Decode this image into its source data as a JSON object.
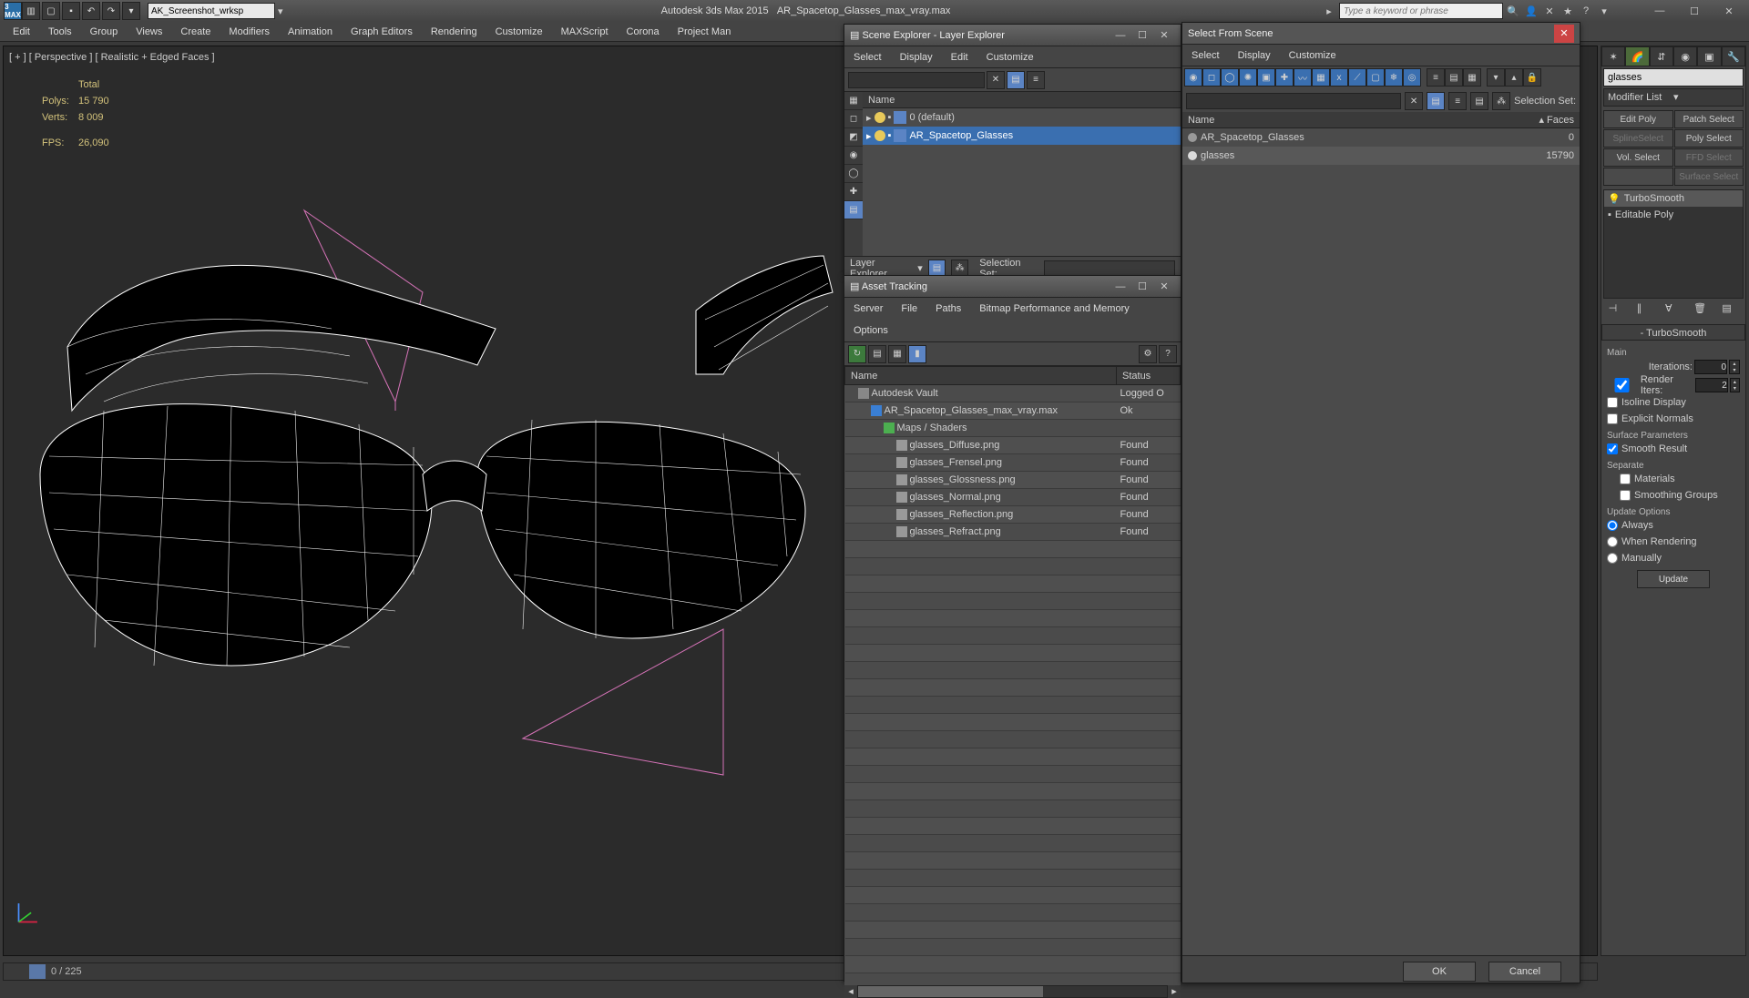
{
  "app": {
    "title_left": "Autodesk 3ds Max  2015",
    "filename": "AR_Spacetop_Glasses_max_vray.max",
    "workspace": "AK_Screenshot_wrksp",
    "search_placeholder": "Type a keyword or phrase"
  },
  "menu": [
    "Edit",
    "Tools",
    "Group",
    "Views",
    "Create",
    "Modifiers",
    "Animation",
    "Graph Editors",
    "Rendering",
    "Customize",
    "MAXScript",
    "Corona",
    "Project Man"
  ],
  "viewport": {
    "label": "[ + ] [ Perspective ] [ Realistic + Edged Faces ]",
    "stats": {
      "total_label": "Total",
      "polys_label": "Polys:",
      "polys": "15 790",
      "verts_label": "Verts:",
      "verts": "8 009",
      "fps_label": "FPS:",
      "fps": "26,090"
    }
  },
  "timeline": {
    "frame": "0 / 225"
  },
  "scene_explorer": {
    "title": "Scene Explorer - Layer Explorer",
    "menu": [
      "Select",
      "Display",
      "Edit",
      "Customize"
    ],
    "name_col": "Name",
    "items": [
      {
        "label": "0 (default)",
        "sel": false
      },
      {
        "label": "AR_Spacetop_Glasses",
        "sel": true
      }
    ],
    "status_label": "Layer Explorer",
    "selset_label": "Selection Set:"
  },
  "asset_tracking": {
    "title": "Asset Tracking",
    "menu": [
      "Server",
      "File",
      "Paths",
      "Bitmap Performance and Memory",
      "Options"
    ],
    "cols": {
      "name": "Name",
      "status": "Status"
    },
    "rows": [
      {
        "name": "Autodesk Vault",
        "status": "Logged O",
        "indent": 1,
        "icon": "#888"
      },
      {
        "name": "AR_Spacetop_Glasses_max_vray.max",
        "status": "Ok",
        "indent": 2,
        "icon": "#3a7fd4"
      },
      {
        "name": "Maps / Shaders",
        "status": "",
        "indent": 3,
        "icon": "#4caf50"
      },
      {
        "name": "glasses_Diffuse.png",
        "status": "Found",
        "indent": 4,
        "icon": "#999"
      },
      {
        "name": "glasses_Frensel.png",
        "status": "Found",
        "indent": 4,
        "icon": "#999"
      },
      {
        "name": "glasses_Glossness.png",
        "status": "Found",
        "indent": 4,
        "icon": "#999"
      },
      {
        "name": "glasses_Normal.png",
        "status": "Found",
        "indent": 4,
        "icon": "#999"
      },
      {
        "name": "glasses_Reflection.png",
        "status": "Found",
        "indent": 4,
        "icon": "#999"
      },
      {
        "name": "glasses_Refract.png",
        "status": "Found",
        "indent": 4,
        "icon": "#999"
      }
    ]
  },
  "select_scene": {
    "title": "Select From Scene",
    "menu": [
      "Select",
      "Display",
      "Customize"
    ],
    "selset_label": "Selection Set:",
    "cols": {
      "name": "Name",
      "faces": "Faces"
    },
    "rows": [
      {
        "name": "AR_Spacetop_Glasses",
        "faces": "0",
        "sel": false
      },
      {
        "name": "glasses",
        "faces": "15790",
        "sel": true
      }
    ],
    "ok": "OK",
    "cancel": "Cancel"
  },
  "cmd": {
    "obj": "glasses",
    "modlist": "Modifier List",
    "sub": [
      "Edit Poly",
      "Patch Select",
      "SplineSelect",
      "Poly Select",
      "Vol. Select",
      "FFD Select",
      "",
      "Surface Select"
    ],
    "stack": [
      "TurboSmooth",
      "Editable Poly"
    ],
    "roll_turbo": "TurboSmooth",
    "main": "Main",
    "iter_label": "Iterations:",
    "iter": "0",
    "rend_label": "Render Iters:",
    "rend": "2",
    "isoline": "Isoline Display",
    "explicit": "Explicit Normals",
    "surf_params": "Surface Parameters",
    "smooth_result": "Smooth Result",
    "separate": "Separate",
    "materials": "Materials",
    "smgroups": "Smoothing Groups",
    "upd_opts": "Update Options",
    "always": "Always",
    "whenrender": "When Rendering",
    "manually": "Manually",
    "update": "Update"
  }
}
